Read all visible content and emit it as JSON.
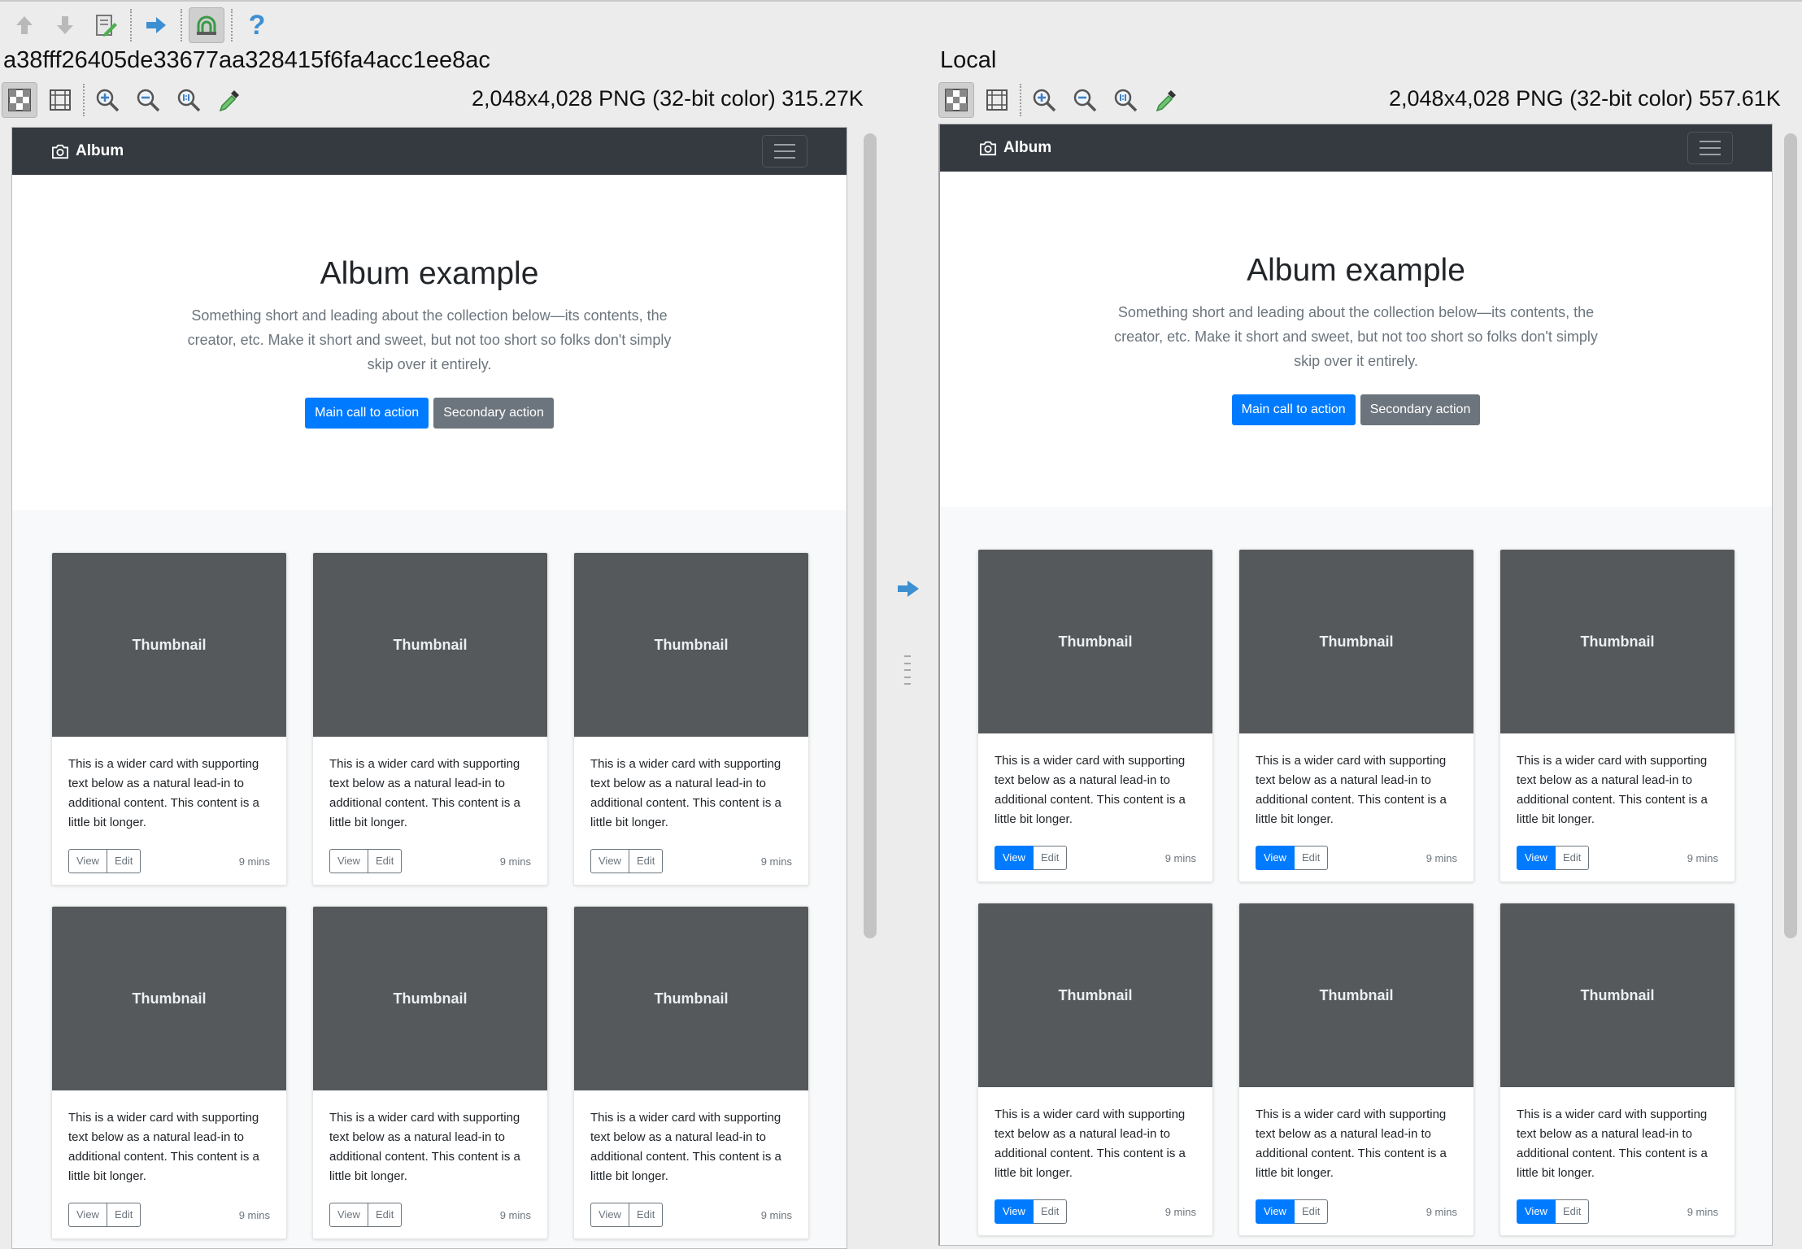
{
  "toolbar": {
    "buttons": [
      "arrow-up-icon",
      "arrow-down-icon",
      "edit-document-icon",
      "arrow-right-icon",
      "merge-icon",
      "help-icon"
    ],
    "help_label": "?"
  },
  "left_panel": {
    "title": "a38fff26405de33677aa328415f6fa4acc1ee8ac",
    "image_info": "2,048x4,028 PNG (32-bit color) 315.27K"
  },
  "right_panel": {
    "title": "Local",
    "image_info": "2,048x4,028 PNG (32-bit color) 557.61K"
  },
  "page": {
    "brand": "Album",
    "hero": {
      "heading": "Album example",
      "lead": "Something short and leading about the collection below—its contents, the creator, etc. Make it short and sweet, but not too short so folks don't simply skip over it entirely.",
      "primary": "Main call to action",
      "secondary": "Secondary action"
    },
    "card": {
      "thumb": "Thumbnail",
      "text": "This is a wider card with supporting text below as a natural lead-in to additional content. This content is a little bit longer.",
      "view": "View",
      "edit": "Edit",
      "mins": "9 mins"
    }
  },
  "colors": {
    "navbar": "#343a40",
    "primary": "#007bff",
    "secondary": "#6c757d",
    "thumbnail": "#55595c",
    "album_bg": "#f8f9fa"
  }
}
